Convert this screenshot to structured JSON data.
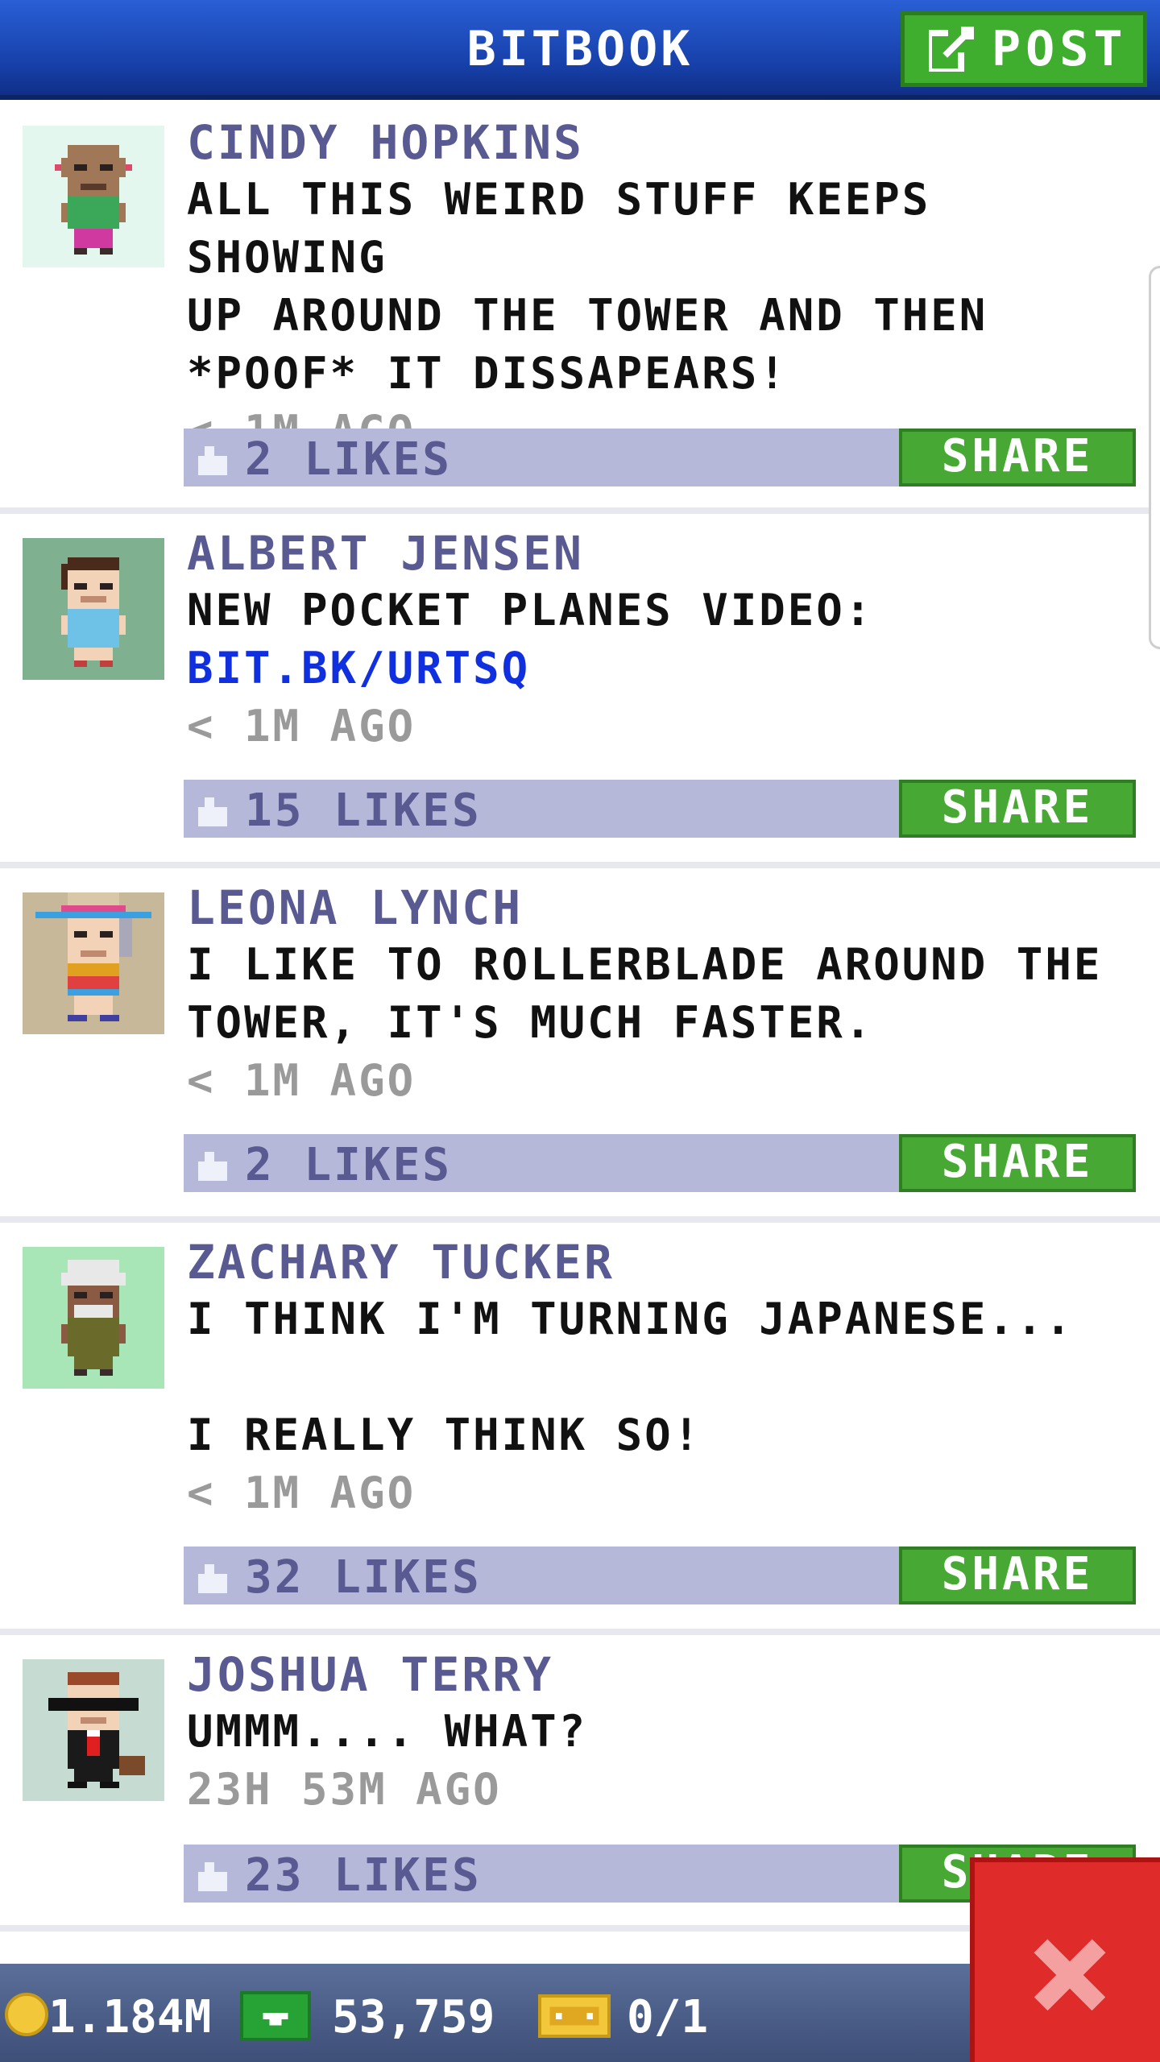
{
  "header": {
    "title": "BITBOOK",
    "post_label": "POST"
  },
  "posts": [
    {
      "author": "CINDY HOPKINS",
      "message": "ALL THIS WEIRD STUFF KEEPS SHOWING\nUP AROUND THE TOWER AND THEN\n*POOF* IT DISSAPEARS!",
      "time": "< 1M AGO",
      "likes": "2 LIKES",
      "share": "SHARE"
    },
    {
      "author": "ALBERT JENSEN",
      "message": "NEW POCKET PLANES VIDEO:",
      "link": "BIT.BK/URTSQ",
      "time": "< 1M AGO",
      "likes": "15 LIKES",
      "share": "SHARE"
    },
    {
      "author": "LEONA LYNCH",
      "message": "I LIKE TO ROLLERBLADE AROUND THE\nTOWER, IT'S MUCH FASTER.",
      "time": "< 1M AGO",
      "likes": "2 LIKES",
      "share": "SHARE"
    },
    {
      "author": "ZACHARY TUCKER",
      "message": "I THINK I'M TURNING JAPANESE...\n\nI REALLY THINK SO!",
      "time": "< 1M AGO",
      "likes": "32 LIKES",
      "share": "SHARE"
    },
    {
      "author": "JOSHUA TERRY",
      "message": "UMMM....  WHAT?",
      "time": "23H 53M AGO",
      "likes": "23 LIKES",
      "share": "SHARE"
    }
  ],
  "status": {
    "coins": "1.184M",
    "bux": "53,759",
    "tickets": "0/1"
  },
  "colors": {
    "header": "#163fa8",
    "post_button": "#3fae2e",
    "like_bar": "#b5b8d8",
    "share": "#47a934",
    "close": "#e02b2b",
    "author": "#5a5a92",
    "link": "#1030e0"
  },
  "icons": {
    "post": "edit-icon",
    "like": "thumbs-up-icon",
    "close": "close-icon",
    "coin": "coin-icon",
    "bux": "bux-icon",
    "ticket": "ticket-icon"
  }
}
